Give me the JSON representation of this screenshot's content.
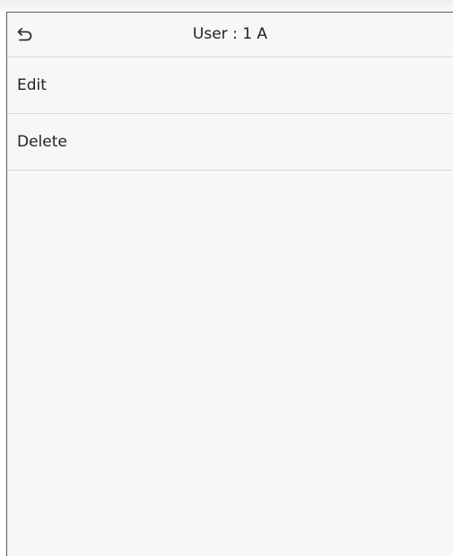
{
  "header": {
    "back_icon": "back-arrow-icon",
    "title": "User : 1 A"
  },
  "menu": {
    "items": [
      {
        "label": "Edit"
      },
      {
        "label": "Delete"
      }
    ]
  }
}
